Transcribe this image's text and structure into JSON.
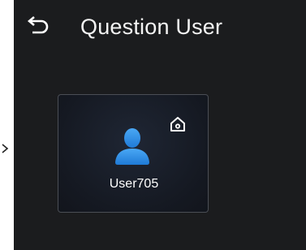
{
  "header": {
    "title": "Question User",
    "back_icon": "back-arrow-icon"
  },
  "users": [
    {
      "name": "User705",
      "avatar_icon": "user-avatar-icon",
      "badge_icon": "home-icon"
    }
  ],
  "colors": {
    "background": "#1b1c1e",
    "card_border": "#4a4e55",
    "avatar_blue": "#2e8fe6",
    "text": "#f4f4f4"
  }
}
